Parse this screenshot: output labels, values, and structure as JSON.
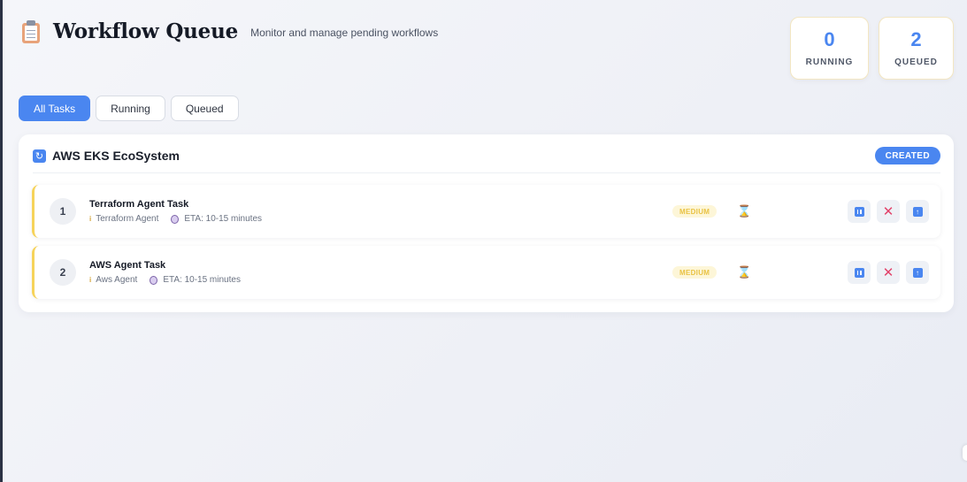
{
  "header": {
    "title": "Workflow Queue",
    "subtitle": "Monitor and manage pending workflows",
    "icon": "clipboard-icon"
  },
  "stats": {
    "running": {
      "value": "0",
      "label": "RUNNING"
    },
    "queued": {
      "value": "2",
      "label": "QUEUED"
    }
  },
  "tabs": [
    {
      "label": "All Tasks",
      "active": true
    },
    {
      "label": "Running",
      "active": false
    },
    {
      "label": "Queued",
      "active": false
    }
  ],
  "workflow": {
    "name": "AWS EKS EcoSystem",
    "icon": "refresh-icon",
    "status": "CREATED",
    "tasks": [
      {
        "number": "1",
        "name": "Terraform Agent Task",
        "agent": "Terraform Agent",
        "eta": "ETA: 10-15 minutes",
        "priority": "MEDIUM",
        "state_icon": "hourglass-icon"
      },
      {
        "number": "2",
        "name": "AWS Agent Task",
        "agent": "Aws Agent",
        "eta": "ETA: 10-15 minutes",
        "priority": "MEDIUM",
        "state_icon": "hourglass-icon"
      }
    ]
  },
  "colors": {
    "accent": "#4a86f0",
    "priority_medium": "#e9c243",
    "cancel": "#e2436a",
    "task_border": "#f6d35a"
  }
}
